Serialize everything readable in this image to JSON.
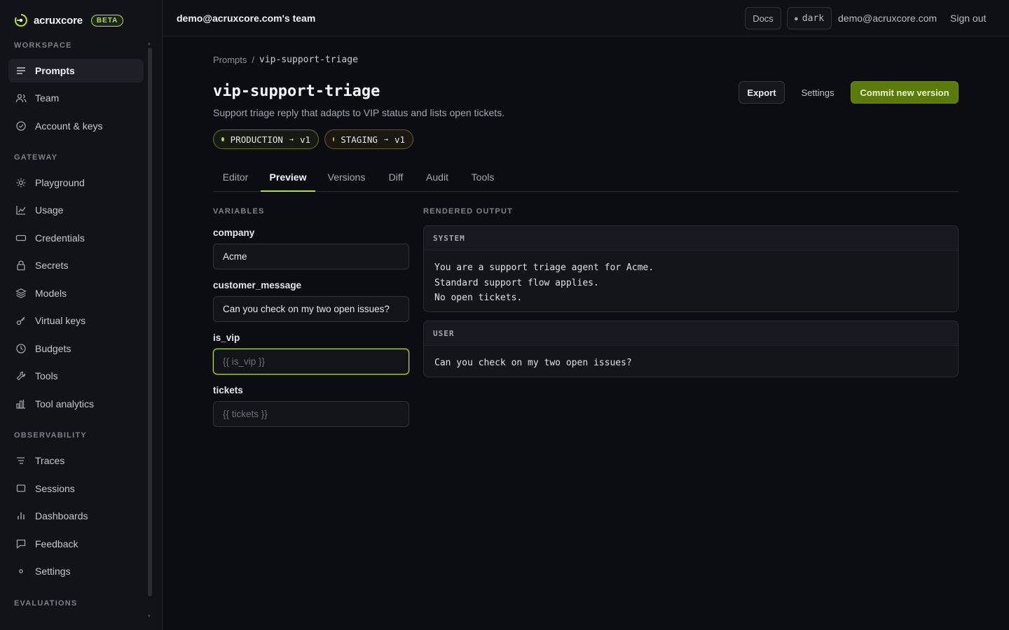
{
  "brand": {
    "name": "acruxcore",
    "badge": "BETA"
  },
  "sidebar": {
    "sections": {
      "workspace": "WORKSPACE",
      "gateway": "GATEWAY",
      "observability": "OBSERVABILITY",
      "evaluations": "EVALUATIONS"
    },
    "items": [
      {
        "label": "Prompts",
        "icon": "lines-icon",
        "active": true
      },
      {
        "label": "Team",
        "icon": "users-icon"
      },
      {
        "label": "Account & keys",
        "icon": "check-circle-icon"
      },
      {
        "label": "Playground",
        "icon": "sun-icon"
      },
      {
        "label": "Usage",
        "icon": "line-chart-icon"
      },
      {
        "label": "Credentials",
        "icon": "card-icon"
      },
      {
        "label": "Secrets",
        "icon": "lock-icon"
      },
      {
        "label": "Models",
        "icon": "layers-icon"
      },
      {
        "label": "Virtual keys",
        "icon": "key-icon"
      },
      {
        "label": "Budgets",
        "icon": "clock-icon"
      },
      {
        "label": "Tools",
        "icon": "wrench-icon"
      },
      {
        "label": "Tool analytics",
        "icon": "bar-chart-icon"
      },
      {
        "label": "Traces",
        "icon": "traces-icon"
      },
      {
        "label": "Sessions",
        "icon": "square-icon"
      },
      {
        "label": "Dashboards",
        "icon": "bars-icon"
      },
      {
        "label": "Feedback",
        "icon": "message-icon"
      },
      {
        "label": "Settings",
        "icon": "gear-icon"
      }
    ]
  },
  "topbar": {
    "team": "demo@acruxcore.com's team",
    "docs": "Docs",
    "theme": "dark",
    "email": "demo@acruxcore.com",
    "signout": "Sign out"
  },
  "page": {
    "breadcrumb_root": "Prompts",
    "breadcrumb_sep": "/",
    "breadcrumb_current": "vip-support-triage",
    "title": "vip-support-triage",
    "subtitle": "Support triage reply that adapts to VIP status and lists open tickets.",
    "export": "Export",
    "settings": "Settings",
    "commit": "Commit new version",
    "envs": [
      {
        "name": "PRODUCTION",
        "arrow": "→",
        "version": "v1",
        "color": "#b5e32c"
      },
      {
        "name": "STAGING",
        "arrow": "→",
        "version": "v1",
        "color": "#e0a93a"
      }
    ],
    "tabs": [
      "Editor",
      "Preview",
      "Versions",
      "Diff",
      "Audit",
      "Tools"
    ],
    "active_tab": "Preview"
  },
  "variables": {
    "label": "VARIABLES",
    "fields": [
      {
        "name": "company",
        "value": "Acme",
        "placeholder": ""
      },
      {
        "name": "customer_message",
        "value": "Can you check on my two open issues?",
        "placeholder": ""
      },
      {
        "name": "is_vip",
        "value": "",
        "placeholder": "{{ is_vip }}"
      },
      {
        "name": "tickets",
        "value": "",
        "placeholder": "{{ tickets }}"
      }
    ]
  },
  "output": {
    "label": "RENDERED OUTPUT",
    "system_label": "SYSTEM",
    "system_lines": [
      "You are a support triage agent for Acme.",
      "Standard support flow applies.",
      "No open tickets."
    ],
    "user_label": "USER",
    "user_lines": [
      "Can you check on my two open issues?"
    ]
  }
}
